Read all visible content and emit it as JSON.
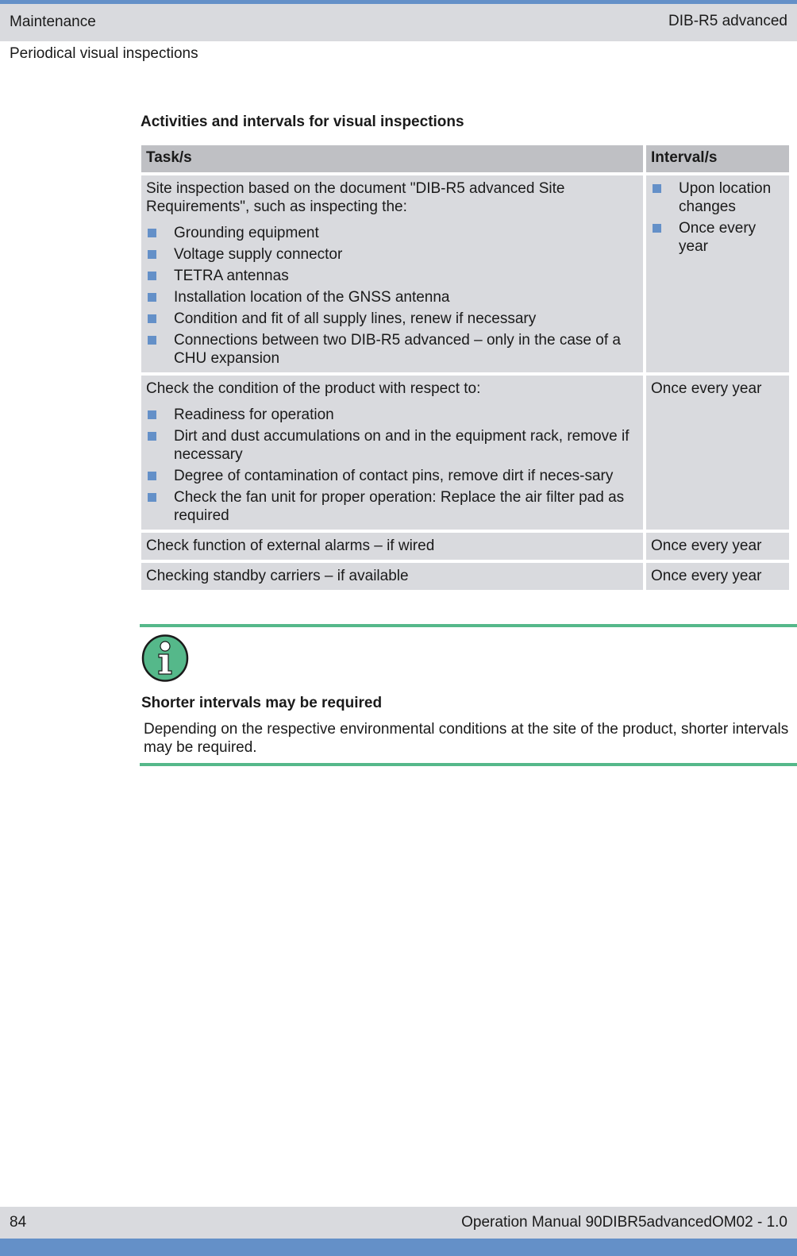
{
  "header": {
    "chapter": "Maintenance",
    "product": "DIB-R5 advanced",
    "section": "Periodical visual inspections"
  },
  "content": {
    "title": "Activities and intervals for visual inspections",
    "table": {
      "headers": {
        "task": "Task/s",
        "interval": "Interval/s"
      },
      "rows": [
        {
          "task_intro": "Site inspection based on the document \"DIB-R5 advanced Site Requirements\", such as inspecting the:",
          "task_items": [
            "Grounding equipment",
            "Voltage supply connector",
            "TETRA antennas",
            "Installation location of the GNSS antenna",
            "Condition and fit of all supply lines, renew if necessary",
            "Connections between two DIB-R5 advanced – only in the case of a CHU expansion"
          ],
          "interval_items": [
            "Upon location changes",
            "Once every year"
          ]
        },
        {
          "task_intro": "Check the condition of the product with respect to:",
          "task_items": [
            "Readiness for operation",
            "Dirt and dust accumulations on and in the equipment rack, remove if necessary",
            "Degree of contamination of contact pins, remove dirt if neces-sary",
            "Check the fan unit for proper operation: Replace the air filter pad as required"
          ],
          "interval": "Once every year"
        },
        {
          "task": "Check function of external alarms – if wired",
          "interval": "Once every year"
        },
        {
          "task": "Checking standby carriers – if available",
          "interval": "Once every year"
        }
      ]
    }
  },
  "note": {
    "icon": "info-icon",
    "title": "Shorter intervals may be required",
    "body": "Depending on the respective environmental conditions at the site of the product, shorter intervals may be required."
  },
  "footer": {
    "page_number": "84",
    "document": "Operation Manual 90DIBR5advancedOM02 - 1.0"
  },
  "colors": {
    "accent_blue": "#6490c8",
    "note_green": "#55b88a",
    "cell_gray": "#d9dade",
    "header_gray": "#bfc0c4"
  }
}
